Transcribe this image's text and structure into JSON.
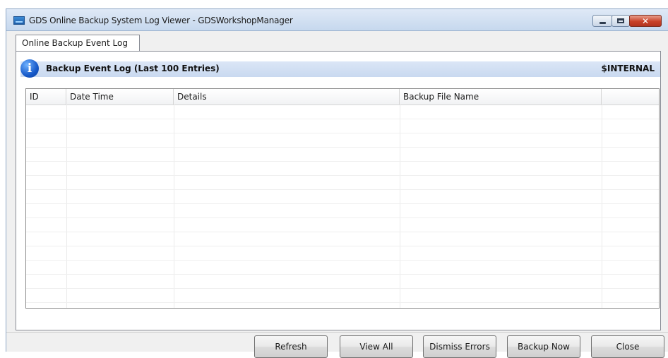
{
  "window": {
    "title": "GDS Online Backup System Log Viewer - GDSWorkshopManager"
  },
  "tabs": [
    {
      "label": "Online Backup Event Log"
    }
  ],
  "info_bar": {
    "title": "Backup Event Log (Last 100 Entries)",
    "tag": "$INTERNAL"
  },
  "grid": {
    "columns": [
      "ID",
      "Date Time",
      "Details",
      "Backup File Name",
      ""
    ],
    "rows": []
  },
  "buttons": {
    "refresh": "Refresh",
    "view_all": "View All",
    "dismiss_errors": "Dismiss Errors",
    "backup_now": "Backup Now",
    "close": "Close"
  },
  "icons": {
    "app": "app-icon",
    "info": "info-icon",
    "minimize": "minimize-icon",
    "maximize": "maximize-icon",
    "close": "close-icon"
  },
  "colors": {
    "title_bar": "#c6d8ee",
    "info_bar": "#c9d9f0",
    "close_button": "#c9432a"
  }
}
